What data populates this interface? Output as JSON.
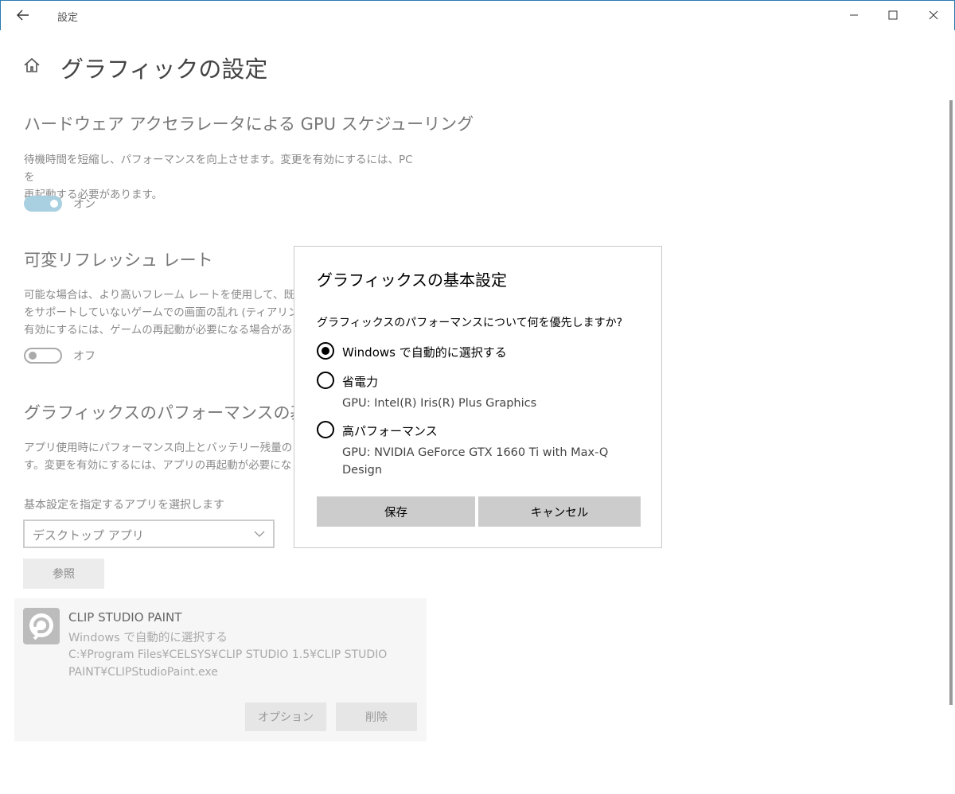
{
  "window": {
    "title": "設定"
  },
  "page": {
    "title": "グラフィックの設定"
  },
  "gpu_scheduling": {
    "title": "ハードウェア アクセラレータによる GPU スケジューリング",
    "description": "待機時間を短縮し、パフォーマンスを向上させます。変更を有効にするには、PC を\n再起動する必要があります。",
    "toggle_state": "on",
    "toggle_label": "オン"
  },
  "vrr": {
    "title": "可変リフレッシュ レート",
    "description": "可能な場合は、より高いフレーム レートを使用して、既定\nをサポートしていないゲームでの画面の乱れ (ティアリング)\n有効にするには、ゲームの再起動が必要になる場合があ",
    "toggle_state": "off",
    "toggle_label": "オフ"
  },
  "perf_pref": {
    "title": "グラフィックスのパフォーマンスの基本設定",
    "description": "アプリ使用時にパフォーマンス向上とバッテリー残量のどち\nす。変更を有効にするには、アプリの再起動が必要にな",
    "select_label": "基本設定を指定するアプリを選択します",
    "select_value": "デスクトップ アプリ",
    "browse_label": "参照"
  },
  "app_entry": {
    "name": "CLIP STUDIO PAINT",
    "setting": "Windows で自動的に選択する",
    "path": "C:¥Program Files¥CELSYS¥CLIP STUDIO 1.5¥CLIP STUDIO PAINT¥CLIPStudioPaint.exe",
    "options_label": "オプション",
    "remove_label": "削除"
  },
  "dialog": {
    "title": "グラフィックスの基本設定",
    "question": "グラフィックスのパフォーマンスについて何を優先しますか?",
    "options": [
      {
        "label": "Windows で自動的に選択する",
        "sub": "",
        "checked": true
      },
      {
        "label": "省電力",
        "sub": "GPU: Intel(R) Iris(R) Plus Graphics",
        "checked": false
      },
      {
        "label": "高パフォーマンス",
        "sub": "GPU: NVIDIA GeForce GTX 1660 Ti with Max-Q Design",
        "checked": false
      }
    ],
    "save_label": "保存",
    "cancel_label": "キャンセル"
  }
}
